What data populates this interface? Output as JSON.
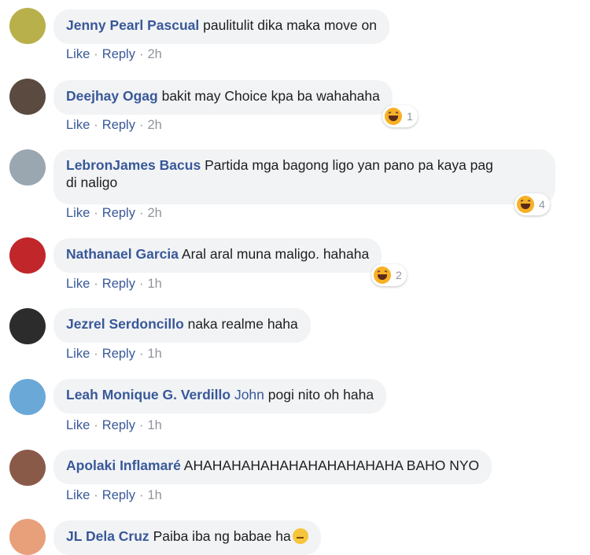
{
  "actions": {
    "like": "Like",
    "reply": "Reply"
  },
  "comments": [
    {
      "author": "Jenny Pearl Pascual",
      "text": "paulitulit dika maka move on",
      "time": "2h",
      "avatar_color": "#b8b04a"
    },
    {
      "author": "Deejhay Ogag",
      "text": "bakit may Choice kpa ba wahahaha",
      "time": "2h",
      "reaction": {
        "icon": "haha-reaction-icon",
        "count": "1"
      },
      "avatar_color": "#5a4a40"
    },
    {
      "author": "LebronJames Bacus",
      "text": "Partida mga bagong ligo yan pano pa kaya pag",
      "text2": "di naligo",
      "time": "2h",
      "reaction": {
        "icon": "haha-reaction-icon",
        "count": "4"
      },
      "avatar_color": "#9aa6b0"
    },
    {
      "author": "Nathanael Garcia",
      "text": "Aral aral muna maligo. hahaha",
      "time": "1h",
      "reaction": {
        "icon": "haha-reaction-icon",
        "count": "2"
      },
      "avatar_color": "#c0262a"
    },
    {
      "author": "Jezrel Serdoncillo",
      "text": "naka realme haha",
      "time": "1h",
      "avatar_color": "#2c2c2c"
    },
    {
      "author": "Leah Monique G. Verdillo",
      "mention": "John",
      "text": "pogi nito oh haha",
      "time": "1h",
      "avatar_color": "#6aa8d8"
    },
    {
      "author": "Apolaki Inflamaré",
      "text": "AHAHAHAHAHAHAHAHAHAHAHA BAHO NYO",
      "time": "1h",
      "avatar_color": "#8a5a48"
    },
    {
      "author": "JL Dela Cruz",
      "text": "Paiba iba ng babae ha",
      "emoji": "worried-face-icon",
      "avatar_color": "#e8a07a"
    }
  ]
}
